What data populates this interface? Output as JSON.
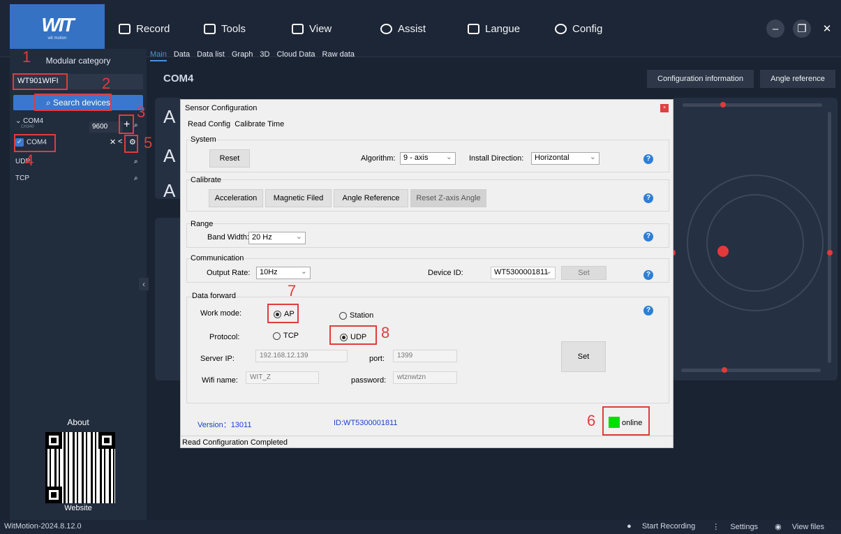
{
  "brand": {
    "logo": "WIT",
    "tagline": "wit motion"
  },
  "menu": [
    {
      "label": "Record",
      "icon": "folder-icon"
    },
    {
      "label": "Tools",
      "icon": "toolbox-icon"
    },
    {
      "label": "View",
      "icon": "monitor-icon"
    },
    {
      "label": "Assist",
      "icon": "cube-icon"
    },
    {
      "label": "Langue",
      "icon": "chat-icon"
    },
    {
      "label": "Config",
      "icon": "gear-icon"
    }
  ],
  "sidebar": {
    "title": "Modular category",
    "model": "WT901WIFI",
    "search": "Search devices",
    "port": "COM4",
    "driver": "CH340",
    "baud": "9600",
    "device": "COM4",
    "udp": "UDP",
    "tcp": "TCP",
    "about": "About",
    "website": "Website"
  },
  "tabs": [
    "Main",
    "Data",
    "Data list",
    "Graph",
    "3D",
    "Cloud Data",
    "Raw data"
  ],
  "header": {
    "port": "COM4",
    "config_info": "Configuration information",
    "angle_ref": "Angle reference"
  },
  "main": {
    "big_letter": "A"
  },
  "dialog": {
    "title": "Sensor Configuration",
    "close": "×",
    "read_config": "Read Config",
    "calibrate_time": "Calibrate Time",
    "system": {
      "label": "System",
      "reset": "Reset",
      "algorithm_label": "Algorithm:",
      "algorithm": "9 - axis",
      "install_label": "Install Direction:",
      "install": "Horizontal"
    },
    "calibrate": {
      "label": "Calibrate",
      "buttons": [
        "Acceleration",
        "Magnetic Filed",
        "Angle Reference",
        "Reset Z-axis Angle"
      ]
    },
    "range": {
      "label": "Range",
      "bandwidth_label": "Band Width:",
      "bandwidth": "20  Hz"
    },
    "comm": {
      "label": "Communication",
      "rate_label": "Output Rate:",
      "rate": "10Hz",
      "device_id_label": "Device ID:",
      "device_id": "WT5300001811",
      "set": "Set"
    },
    "forward": {
      "label": "Data forward",
      "work_mode_label": "Work mode:",
      "ap": "AP",
      "station": "Station",
      "protocol_label": "Protocol:",
      "tcp": "TCP",
      "udp": "UDP",
      "server_ip_label": "Server IP:",
      "server_ip": "192.168.12.139",
      "port_label": "port:",
      "port": "1399",
      "wifi_label": "Wifi name:",
      "wifi": "WIT_Z",
      "password_label": "password:",
      "password": "wtznwtzn",
      "set": "Set"
    },
    "version": "Version：13011",
    "id": "ID:WT5300001811",
    "online": "online",
    "status": "Read Configuration Completed"
  },
  "annotations": [
    "1",
    "2",
    "3",
    "4",
    "5",
    "6",
    "7",
    "8"
  ],
  "statusbar": {
    "version": "WitMotion-2024.8.12.0",
    "start_recording": "Start Recording",
    "settings": "Settings",
    "view_files": "View files"
  },
  "colors": {
    "accent": "#3a78d0",
    "highlight": "#e03c3c",
    "online": "#00e000"
  }
}
